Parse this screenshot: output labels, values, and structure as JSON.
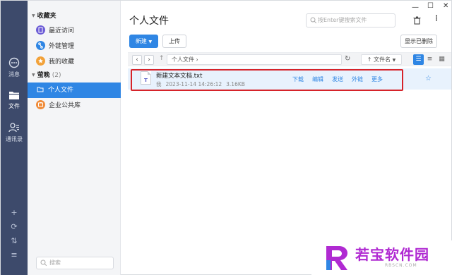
{
  "rail": {
    "items": [
      {
        "label": "消息",
        "icon": "message-icon"
      },
      {
        "label": "文件",
        "icon": "folder-icon"
      },
      {
        "label": "通讯录",
        "icon": "contacts-icon"
      }
    ],
    "bottom_icons": [
      "plus-icon",
      "sync-icon",
      "sort-icon",
      "menu-icon"
    ]
  },
  "panel": {
    "favorites_title": "收藏夹",
    "favorites": [
      {
        "label": "最近访问",
        "color": "#6b5bd6"
      },
      {
        "label": "外链管理",
        "color": "#2f86e4"
      },
      {
        "label": "我的收藏",
        "color": "#f2a23a"
      }
    ],
    "group_title": "萤晚",
    "group_count": "(2)",
    "group_items": [
      {
        "label": "个人文件",
        "active": true
      },
      {
        "label": "企业公共库",
        "active": false
      }
    ],
    "search_placeholder": "搜索"
  },
  "main": {
    "title": "个人文件",
    "search_placeholder": "按Enter键搜索文件",
    "new_button": "新建",
    "upload_button": "上传",
    "show_deleted_button": "显示已删除",
    "path": "个人文件",
    "sort_label": "文件名",
    "file": {
      "name": "新建文本文档.txt",
      "owner": "我",
      "datetime": "2023-11-14 14:26:12",
      "size": "3.16KB",
      "type_letter": "T"
    },
    "actions": [
      "下载",
      "编辑",
      "发送",
      "外链",
      "更多"
    ]
  },
  "watermark": {
    "text": "若宝软件园",
    "sub": "RBSCN.COM",
    "colors": {
      "primary": "#b02ad2",
      "secondary": "#2f86e4"
    }
  },
  "colors": {
    "accent": "#2f86e4",
    "rail": "#3d4a6b",
    "highlight": "#d6232a"
  }
}
